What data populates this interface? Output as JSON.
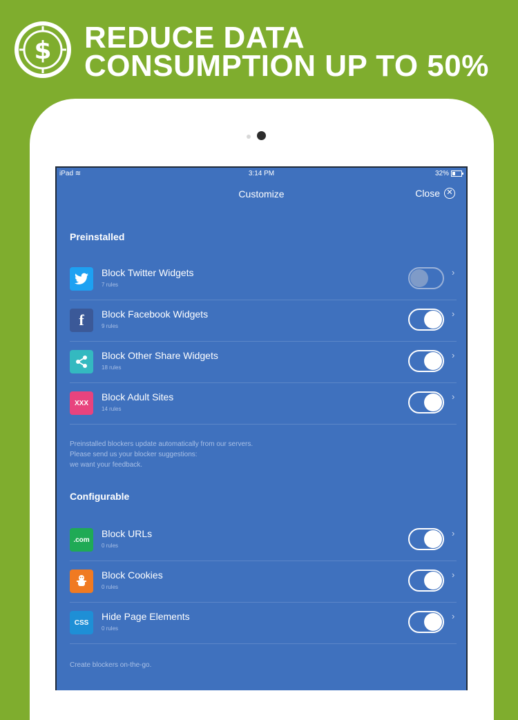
{
  "promo": {
    "icon": "dollar-clock-icon",
    "title_line1": "REDUCE DATA",
    "title_line2": "CONSUMPTION UP TO 50%"
  },
  "status_bar": {
    "device": "iPad",
    "time": "3:14 PM",
    "battery": "32%"
  },
  "nav": {
    "title": "Customize",
    "close_label": "Close"
  },
  "preinstalled": {
    "heading": "Preinstalled",
    "items": [
      {
        "title": "Block Twitter Widgets",
        "rules": "7 rules",
        "icon": "twitter-icon",
        "color": "#1da1f2",
        "enabled": false
      },
      {
        "title": "Block Facebook Widgets",
        "rules": "9 rules",
        "icon": "facebook-icon",
        "color": "#3b5998",
        "enabled": true
      },
      {
        "title": "Block Other Share Widgets",
        "rules": "18 rules",
        "icon": "share-icon",
        "color": "#34b9c0",
        "enabled": true
      },
      {
        "title": "Block Adult Sites",
        "rules": "14 rules",
        "icon": "xxx-icon",
        "icon_text": "XXX",
        "color": "#e8437e",
        "enabled": true
      }
    ],
    "note_line1": "Preinstalled blockers update automatically from our servers.",
    "note_line2": "Please send us your blocker suggestions:",
    "note_line3": "we want your feedback."
  },
  "configurable": {
    "heading": "Configurable",
    "items": [
      {
        "title": "Block URLs",
        "rules": "0 rules",
        "icon": "dotcom-icon",
        "icon_text": ".com",
        "color": "#1faa55",
        "enabled": true
      },
      {
        "title": "Block Cookies",
        "rules": "0 rules",
        "icon": "cookie-icon",
        "color": "#f07a22",
        "enabled": true
      },
      {
        "title": "Hide Page Elements",
        "rules": "0 rules",
        "icon": "css-icon",
        "icon_text": "CSS",
        "color": "#1e8fd6",
        "enabled": true
      }
    ],
    "note": "Create blockers on-the-go."
  }
}
